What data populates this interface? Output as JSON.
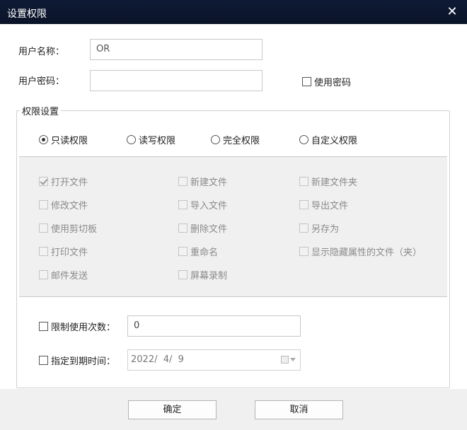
{
  "window": {
    "title": "设置权限",
    "close_glyph": "✕"
  },
  "form": {
    "username_label": "用户名称：",
    "username_value": "OR",
    "password_label": "用户密码：",
    "password_value": "",
    "use_password_label": "使用密码"
  },
  "permissions": {
    "legend": "权限设置",
    "modes": [
      {
        "label": "只读权限",
        "selected": true
      },
      {
        "label": "读写权限",
        "selected": false
      },
      {
        "label": "完全权限",
        "selected": false
      },
      {
        "label": "自定义权限",
        "selected": false
      }
    ],
    "items": [
      {
        "label": "打开文件",
        "checked": true
      },
      {
        "label": "新建文件",
        "checked": false
      },
      {
        "label": "新建文件夹",
        "checked": false
      },
      {
        "label": "修改文件",
        "checked": false
      },
      {
        "label": "导入文件",
        "checked": false
      },
      {
        "label": "导出文件",
        "checked": false
      },
      {
        "label": "使用剪切板",
        "checked": false
      },
      {
        "label": "删除文件",
        "checked": false
      },
      {
        "label": "另存为",
        "checked": false
      },
      {
        "label": "打印文件",
        "checked": false
      },
      {
        "label": "重命名",
        "checked": false
      },
      {
        "label": "显示隐藏属性的文件（夹）",
        "checked": false
      },
      {
        "label": "邮件发送",
        "checked": false
      },
      {
        "label": "屏幕录制",
        "checked": false
      }
    ]
  },
  "limits": {
    "usage_limit_label": "限制使用次数：",
    "usage_limit_value": "0",
    "expiry_label": "指定到期时间：",
    "expiry_value": "2022/  4/  9"
  },
  "buttons": {
    "ok": "确定",
    "cancel": "取消"
  }
}
